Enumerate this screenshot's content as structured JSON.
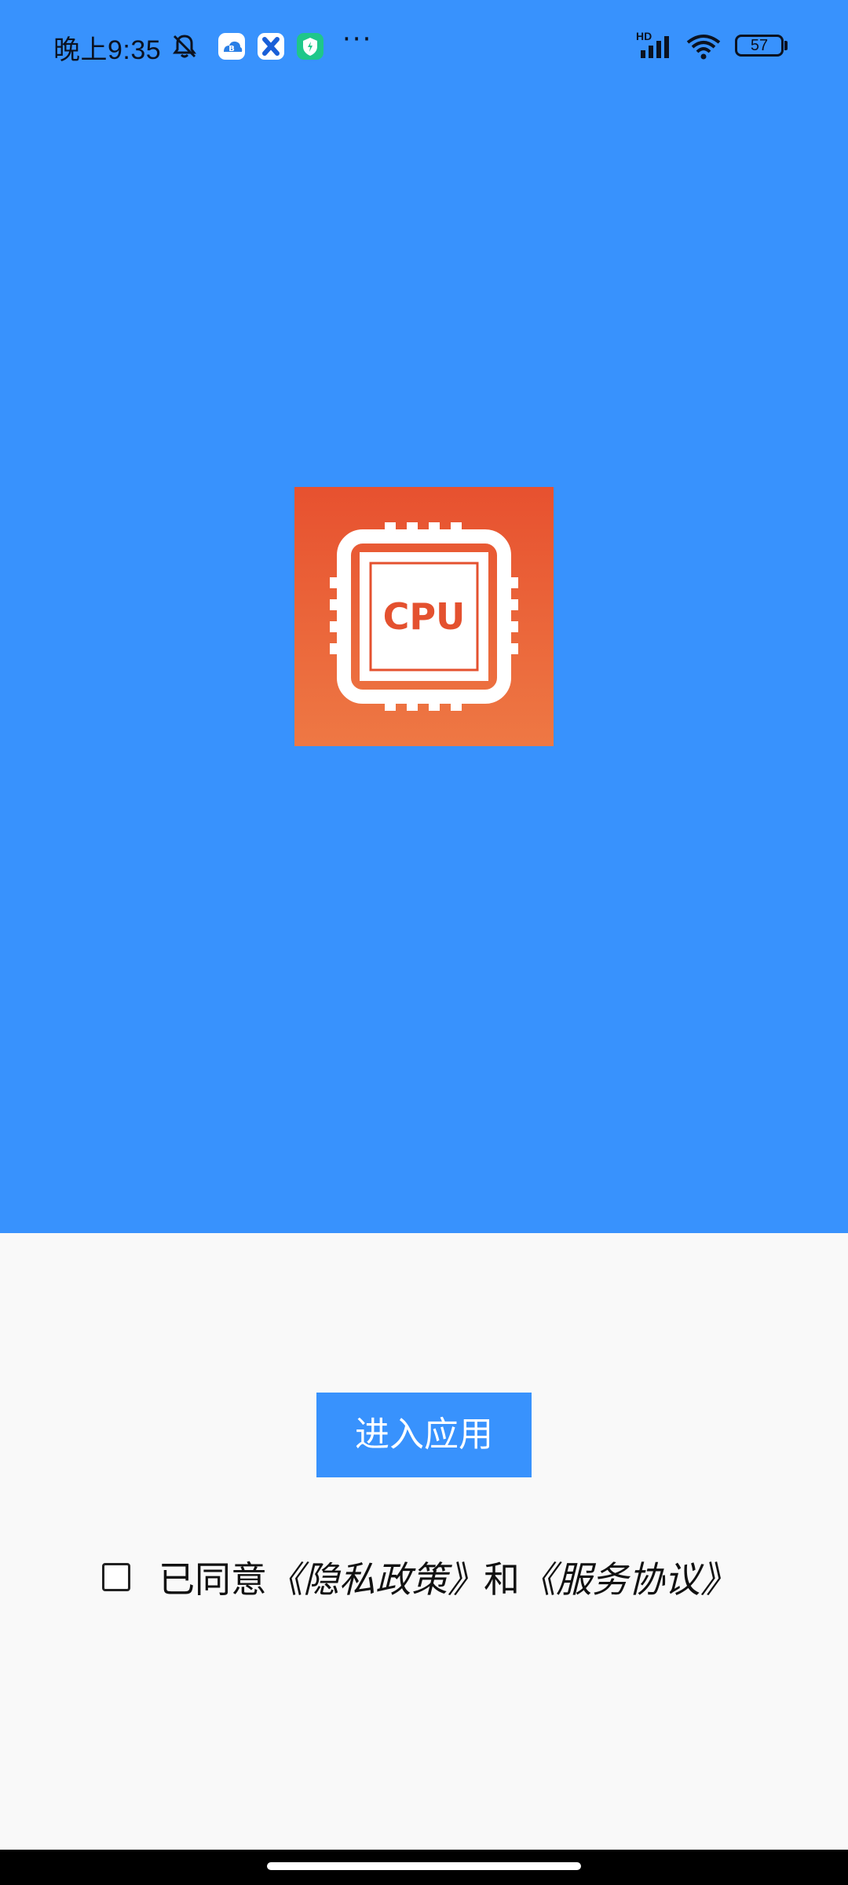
{
  "status_bar": {
    "time": "晚上9:35",
    "more": "···",
    "signal_label": "HD",
    "battery": "57",
    "icons": [
      "mute-icon",
      "cloud-app-icon",
      "x-app-icon",
      "shield-app-icon",
      "signal-icon",
      "wifi-icon",
      "battery-icon"
    ]
  },
  "splash": {
    "logo_icon": "cpu-chip-icon",
    "logo_text": "CPU"
  },
  "main": {
    "enter_button": "进入应用"
  },
  "consent": {
    "prefix": "已同意",
    "privacy_link": "《隐私政策》",
    "conjunction": "和",
    "service_link": "《服务协议》",
    "checked": false
  },
  "colors": {
    "primary": "#3892fd",
    "logo_top": "#e7512f",
    "logo_bottom": "#ee7844",
    "background": "#f9f9f9"
  }
}
